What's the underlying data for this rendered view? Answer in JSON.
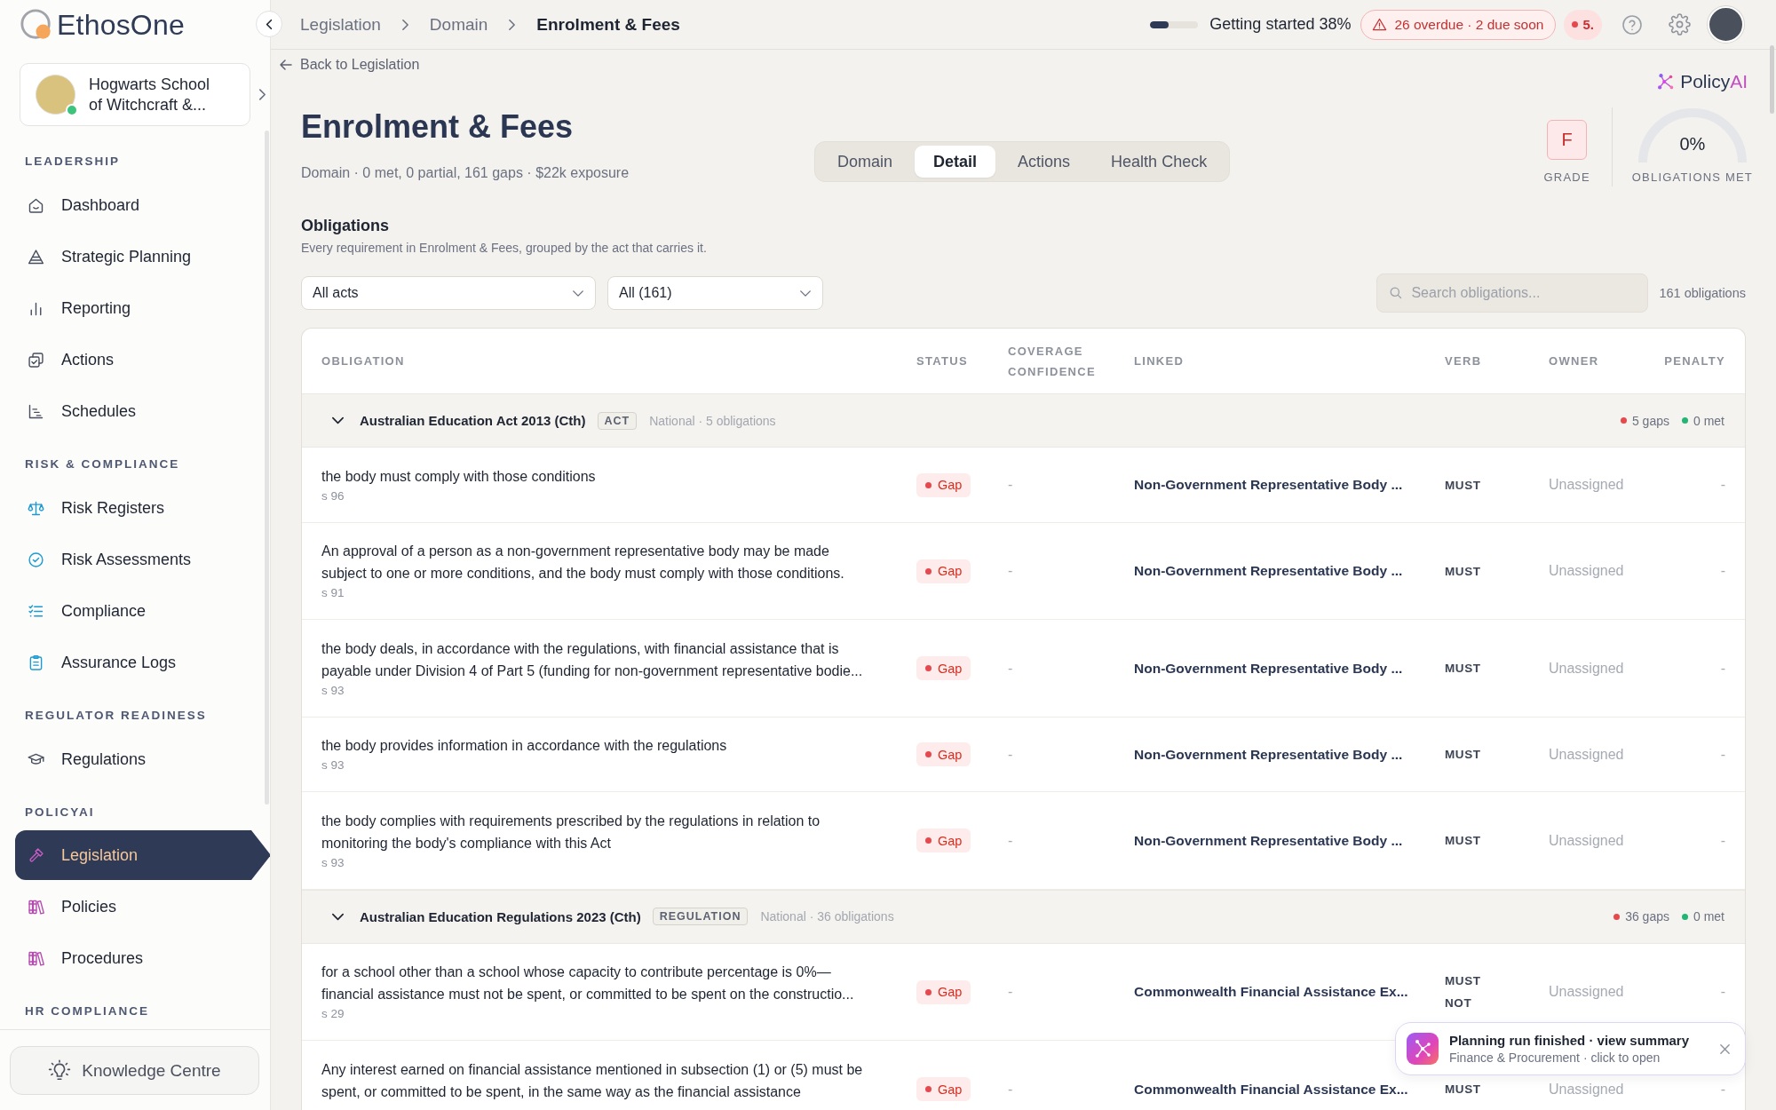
{
  "sidebar": {
    "brand": "EthosOne",
    "school": {
      "name": "Hogwarts School of Witchcraft &...",
      "online": true
    },
    "sections": [
      {
        "title": "LEADERSHIP",
        "items": [
          {
            "label": "Dashboard",
            "selected": false
          },
          {
            "label": "Strategic Planning",
            "selected": false
          },
          {
            "label": "Reporting",
            "selected": false
          },
          {
            "label": "Actions",
            "selected": false
          },
          {
            "label": "Schedules",
            "selected": false
          }
        ]
      },
      {
        "title": "RISK & COMPLIANCE",
        "items": [
          {
            "label": "Risk Registers",
            "selected": false
          },
          {
            "label": "Risk Assessments",
            "selected": false
          },
          {
            "label": "Compliance",
            "selected": false
          },
          {
            "label": "Assurance Logs",
            "selected": false
          }
        ]
      },
      {
        "title": "REGULATOR READINESS",
        "items": [
          {
            "label": "Regulations",
            "selected": false
          }
        ]
      },
      {
        "title": "POLICYAI",
        "items": [
          {
            "label": "Legislation",
            "selected": true
          },
          {
            "label": "Policies",
            "selected": false
          },
          {
            "label": "Procedures",
            "selected": false
          }
        ]
      },
      {
        "title": "HR COMPLIANCE"
      }
    ],
    "footer_button": "Knowledge Centre"
  },
  "topbar": {
    "breadcrumb": [
      {
        "label": "Legislation",
        "current": false
      },
      {
        "label": "Domain",
        "current": false
      },
      {
        "label": "Enrolment & Fees",
        "current": true
      }
    ],
    "progress": {
      "level": 0.38,
      "label": "Getting started 38%"
    },
    "alert": "26 overdue · 2 due soon",
    "notifications": "5."
  },
  "page": {
    "back_link": "Back to Legislation",
    "title": "Enrolment & Fees",
    "subtitle": "Domain · 0 met, 0 partial, 161 gaps · $22k exposure",
    "tabs": [
      {
        "label": "Domain",
        "selected": false
      },
      {
        "label": "Detail",
        "selected": true
      },
      {
        "label": "Actions",
        "selected": false
      },
      {
        "label": "Health Check",
        "selected": false
      }
    ],
    "brand": {
      "text": "Policy",
      "accent": "AI"
    },
    "grade": {
      "value": "F",
      "label": "GRADE"
    },
    "gauge": {
      "value": "0%",
      "label": "OBLIGATIONS MET"
    }
  },
  "obligations": {
    "title": "Obligations",
    "description": "Every requirement in Enrolment & Fees, grouped by the act that carries it.",
    "filters": [
      {
        "value": "All acts"
      },
      {
        "value": "All (161)"
      }
    ],
    "search": {
      "placeholder": "Search obligations..."
    },
    "count": "161 obligations",
    "table": {
      "columns": [
        "OBLIGATION",
        "STATUS",
        "COVERAGE CONFIDENCE",
        "LINKED",
        "VERB",
        "OWNER",
        "PENALTY"
      ],
      "groups": [
        {
          "title": "Australian Education Act 2013 (Cth)",
          "badge": "ACT",
          "meta": "National · 5 obligations",
          "expanded": true,
          "gaps": "5 gaps",
          "met": "0 met",
          "rows": [
            {
              "text": "the body must comply with those conditions",
              "section": "s 96",
              "status": "Gap",
              "coverage": "-",
              "linked": "Non-Government Representative Body ...",
              "verb": "MUST",
              "owner": "Unassigned",
              "penalty": "-"
            },
            {
              "text": "An approval of a person as a non-government representative body may be made subject to one or more conditions, and the body must comply with those conditions.",
              "section": "s 91",
              "status": "Gap",
              "coverage": "-",
              "linked": "Non-Government Representative Body ...",
              "verb": "MUST",
              "owner": "Unassigned",
              "penalty": "-"
            },
            {
              "text": "the body deals, in accordance with the regulations, with financial assistance that is payable under Division 4 of Part 5 (funding for non-government representative bodie...",
              "section": "s 93",
              "status": "Gap",
              "coverage": "-",
              "linked": "Non-Government Representative Body ...",
              "verb": "MUST",
              "owner": "Unassigned",
              "penalty": "-"
            },
            {
              "text": "the body provides information in accordance with the regulations",
              "section": "s 93",
              "status": "Gap",
              "coverage": "-",
              "linked": "Non-Government Representative Body ...",
              "verb": "MUST",
              "owner": "Unassigned",
              "penalty": "-"
            },
            {
              "text": "the body complies with requirements prescribed by the regulations in relation to monitoring the body's compliance with this Act",
              "section": "s 93",
              "status": "Gap",
              "coverage": "-",
              "linked": "Non-Government Representative Body ...",
              "verb": "MUST",
              "owner": "Unassigned",
              "penalty": "-"
            }
          ]
        },
        {
          "title": "Australian Education Regulations 2023 (Cth)",
          "badge": "REGULATION",
          "meta": "National · 36 obligations",
          "expanded": true,
          "gaps": "36 gaps",
          "met": "0 met",
          "rows": [
            {
              "text": "for a school other than a school whose capacity to contribute percentage is 0%—financial assistance must not be spent, or committed to be spent on the constructio...",
              "section": "s 29",
              "status": "Gap",
              "coverage": "-",
              "linked": "Commonwealth Financial Assistance Ex...",
              "verb": "MUST NOT",
              "owner": "Unassigned",
              "penalty": "-"
            },
            {
              "text": "Any interest earned on financial assistance mentioned in subsection (1) or (5) must be spent, or committed to be spent, in the same way as the financial assistance",
              "status": "Gap",
              "coverage": "-",
              "linked": "Commonwealth Financial Assistance Ex...",
              "verb": "MUST",
              "owner": "Unassigned",
              "penalty": "-"
            }
          ]
        }
      ]
    }
  },
  "toast": {
    "title": "Planning run finished · view summary",
    "subtitle": "Finance & Procurement · click to open"
  }
}
